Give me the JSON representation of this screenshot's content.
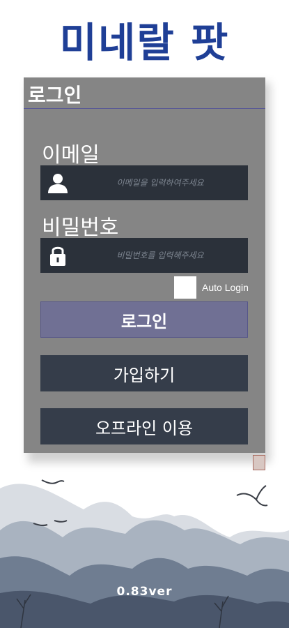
{
  "app": {
    "title": "미네랄 팟"
  },
  "panel": {
    "title": "로그인"
  },
  "email": {
    "label": "이메일",
    "placeholder": "이메일을 입력하여주세요",
    "value": ""
  },
  "password": {
    "label": "비밀번호",
    "placeholder": "비밀번호를 입력해주세요",
    "value": ""
  },
  "auto_login": {
    "label": "Auto Login",
    "checked": false
  },
  "buttons": {
    "login": "로그인",
    "signup": "가입하기",
    "offline": "오프라인 이용"
  },
  "version": "0.83ver",
  "colors": {
    "title": "#1f3f96",
    "panel": "#858585",
    "input_bg": "#2b313a",
    "login_button": "#707094",
    "button_bg": "#353d4a"
  }
}
